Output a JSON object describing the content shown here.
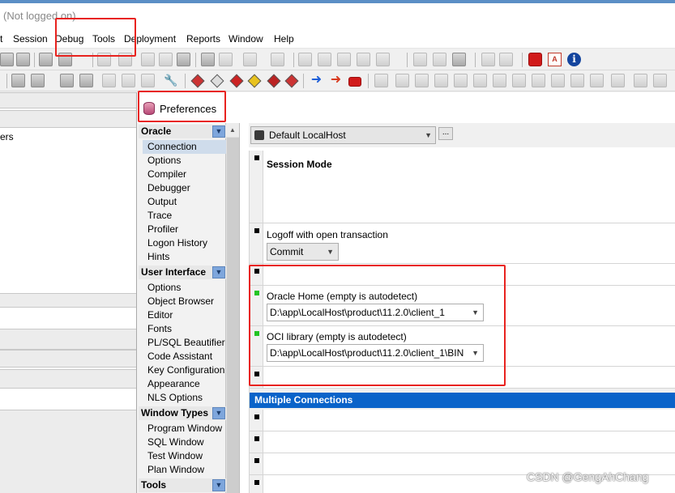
{
  "window": {
    "title": "(Not logged on)"
  },
  "menu": {
    "items": [
      "t",
      "Session",
      "Debug",
      "Tools",
      "Deployment",
      "Reports",
      "Window",
      "Help"
    ]
  },
  "left_panel": {
    "text": "ers"
  },
  "preferences": {
    "title": "Preferences",
    "categories": [
      {
        "title": "Oracle",
        "items": [
          "Connection",
          "Options",
          "Compiler",
          "Debugger",
          "Output",
          "Trace",
          "Profiler",
          "Logon History",
          "Hints"
        ]
      },
      {
        "title": "User Interface",
        "items": [
          "Options",
          "Object Browser",
          "Editor",
          "Fonts",
          "PL/SQL Beautifier",
          "Code Assistant",
          "Key Configuration",
          "Appearance",
          "NLS Options"
        ]
      },
      {
        "title": "Window Types",
        "items": [
          "Program Window",
          "SQL Window",
          "Test Window",
          "Plan Window"
        ]
      },
      {
        "title": "Tools",
        "items": []
      }
    ],
    "selected_item": "Connection",
    "session_select": "Default LocalHost",
    "more_button": "...",
    "sections": {
      "session_mode": "Session Mode",
      "logoff_label": "Logoff with open transaction",
      "logoff_value": "Commit",
      "oracle_home_label": "Oracle Home (empty is autodetect)",
      "oracle_home_value": "D:\\app\\LocalHost\\product\\11.2.0\\client_1",
      "oci_label": "OCI library (empty is autodetect)",
      "oci_value": "D:\\app\\LocalHost\\product\\11.2.0\\client_1\\BIN",
      "multiple_connections": "Multiple Connections"
    }
  },
  "watermark": "CSDN @GengAhChang",
  "colors": {
    "group_header": "#0a63c9",
    "highlight": "#e8231f",
    "selected_item": "#cfdceb"
  }
}
